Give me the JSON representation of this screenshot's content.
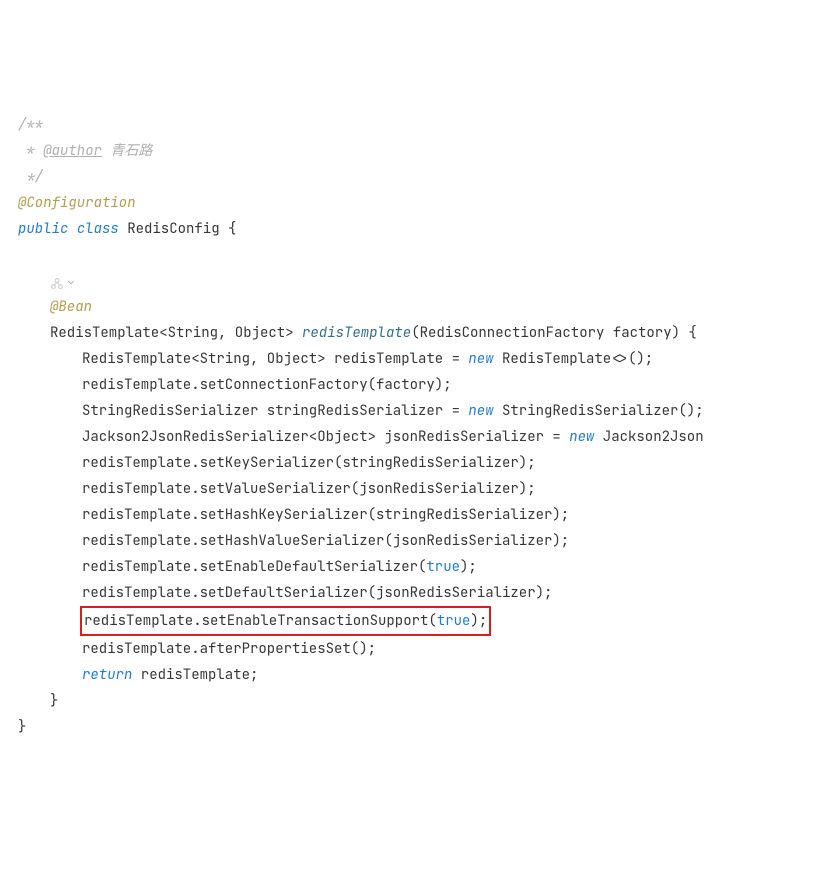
{
  "doc": {
    "open": "/**",
    "authorTag": "@author",
    "authorName": " 青石路",
    "close": " */",
    "star": " * "
  },
  "annotations": {
    "configuration": "@Configuration",
    "bean": "@Bean"
  },
  "keywords": {
    "public": "public",
    "class": "class",
    "new": "new",
    "return": "return"
  },
  "identifiers": {
    "className": "RedisConfig",
    "methodName": "redisTemplate"
  },
  "lines": {
    "classDecl_tail": " RedisConfig {",
    "methodSig_head": "RedisTemplate<String, Object> ",
    "methodSig_tail": "(RedisConnectionFactory factory) {",
    "l1_head": "RedisTemplate<String, Object> redisTemplate = ",
    "l1_tail": " RedisTemplate<>();",
    "l2": "redisTemplate.setConnectionFactory(factory);",
    "l3_head": "StringRedisSerializer stringRedisSerializer = ",
    "l3_tail": " StringRedisSerializer();",
    "l4_head": "Jackson2JsonRedisSerializer<Object> jsonRedisSerializer = ",
    "l4_tail": " Jackson2Json",
    "l5": "redisTemplate.setKeySerializer(stringRedisSerializer);",
    "l6": "redisTemplate.setValueSerializer(jsonRedisSerializer);",
    "l7": "redisTemplate.setHashKeySerializer(stringRedisSerializer);",
    "l8": "redisTemplate.setHashValueSerializer(jsonRedisSerializer);",
    "l9_head": "redisTemplate.setEnableDefaultSerializer(",
    "l9_tail": ");",
    "l10": "redisTemplate.setDefaultSerializer(jsonRedisSerializer);",
    "l11_head": "redisTemplate.setEnableTransactionSupport(",
    "l11_tail": ");",
    "l12": "redisTemplate.afterPropertiesSet();",
    "l13_tail": " redisTemplate;",
    "close_inner": "}",
    "close_outer": "}"
  },
  "bools": {
    "true": "true"
  },
  "gutter": {
    "chevron": "⌄"
  }
}
